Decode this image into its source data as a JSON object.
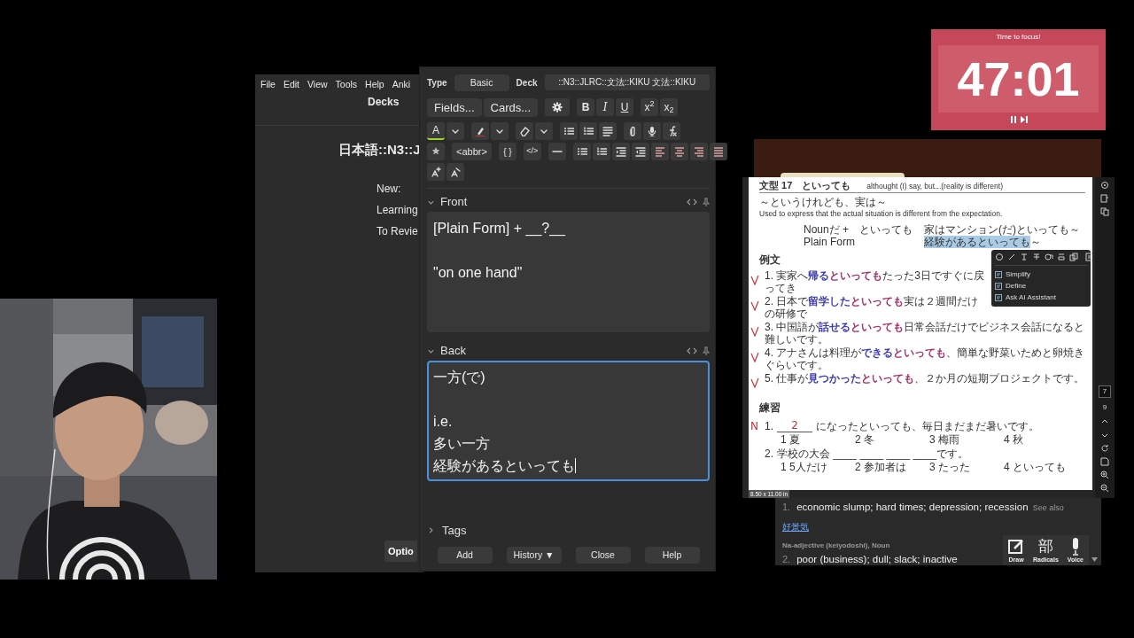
{
  "anki_main": {
    "menu": [
      "File",
      "Edit",
      "View",
      "Tools",
      "Help",
      "Anki"
    ],
    "heading": "Decks",
    "deck_name": "日本語::N3::J",
    "stats": [
      "New:",
      "Learning",
      "To Revie"
    ],
    "options_button": "Optio"
  },
  "editor": {
    "type_label": "Type",
    "note_type": "Basic",
    "deck_label": "Deck",
    "deck": "::N3::JLRC::文法::KIKU 文法::KIKU",
    "toolbar": {
      "fields": "Fields...",
      "cards": "Cards...",
      "bold": "B",
      "italic": "I",
      "underline": "U",
      "superscript": "x$^{2}$",
      "subscript": "x$_{2}$",
      "text_color": "A",
      "abbr": "<abbr>",
      "braces": "{ }",
      "code": "</>"
    },
    "fields": [
      {
        "name": "Front",
        "expanded": true,
        "focused": false,
        "caret": false,
        "lines": [
          {
            "text": "[Plain Form] + __?__"
          },
          {
            "text": "\"on one hand\"",
            "space_before": true
          }
        ]
      },
      {
        "name": "Back",
        "expanded": true,
        "focused": true,
        "caret": true,
        "lines": [
          {
            "text": "一方(で)"
          },
          {
            "text": "i.e.",
            "space_before": true
          },
          {
            "text": "多い一方"
          },
          {
            "text": "経験があるといっても"
          }
        ]
      }
    ],
    "tags": {
      "label": "Tags",
      "expanded": false
    },
    "buttons": [
      "Add",
      "History ▼",
      "Close",
      "Help"
    ]
  },
  "timer": {
    "label": "Time to focus!",
    "time": "47:01"
  },
  "pdf": {
    "title": "文型 17　といっても",
    "title_gloss": "althought (I) say, but...(reality is different)",
    "pattern": "～というけれども、実は～",
    "explanation": "Used to express that the actual situation is different from the expectation.",
    "forms": [
      {
        "form": "Nounだ +　といっても",
        "example": [
          {
            "text": "家はマンション(だ)といっても～",
            "selected": false
          }
        ]
      },
      {
        "form": "Plain Form",
        "example": [
          {
            "text": "経験があるといっても",
            "selected": true
          },
          {
            "text": "～",
            "selected": false
          }
        ]
      }
    ],
    "examples_heading": "例文",
    "examples": [
      {
        "checked": true,
        "segments": [
          {
            "text": "1. 実家へ"
          },
          {
            "text": "帰る",
            "color": "#3c3cb0"
          },
          {
            "text": "といっても",
            "color": "#a8306c"
          },
          {
            "text": "たった3日ですぐに戻ってき"
          }
        ]
      },
      {
        "checked": true,
        "segments": [
          {
            "text": "2. 日本で"
          },
          {
            "text": "留学した",
            "color": "#3c3cb0"
          },
          {
            "text": "といっても",
            "color": "#a8306c"
          },
          {
            "text": "実は２週間だけの研修で"
          }
        ]
      },
      {
        "checked": true,
        "segments": [
          {
            "text": "3. 中国語が"
          },
          {
            "text": "話せる",
            "color": "#3c3cb0"
          },
          {
            "text": "といっても",
            "color": "#a8306c"
          },
          {
            "text": "日常会話だけでビジネス会話になると難しいです。"
          }
        ]
      },
      {
        "checked": true,
        "segments": [
          {
            "text": "4. アナさんは料理が"
          },
          {
            "text": "できる",
            "color": "#3c3cb0"
          },
          {
            "text": "といっても",
            "color": "#a8306c"
          },
          {
            "text": "、簡単な野菜いためと卵焼きぐらいです。"
          }
        ]
      },
      {
        "checked": true,
        "segments": [
          {
            "text": "5. 仕事が"
          },
          {
            "text": "見つかった",
            "color": "#3c3cb0"
          },
          {
            "text": "といっても",
            "color": "#a8306c"
          },
          {
            "text": "、２か月の短期プロジェクトです。"
          }
        ]
      }
    ],
    "practice_heading": "練習",
    "exercises": [
      {
        "grade": "N",
        "number": "1.",
        "answer": "2",
        "text": "になったといっても、毎日まだまだ暑いです。",
        "choices": [
          "1 夏",
          "2 冬",
          "3 梅雨",
          "4 秋"
        ]
      },
      {
        "number": "2.",
        "text": "学校の大会 ____ ____ ____ ____です。",
        "choices": [
          "1 5人だけ",
          "2 参加者は",
          "3 たった",
          "4 といっても"
        ]
      }
    ],
    "popup": {
      "items": [
        "Simplify",
        "Define",
        "Ask AI Assistant"
      ]
    },
    "page_numbers": [
      "7",
      "9"
    ],
    "page_size": "8.50 x 11.00 in"
  },
  "dictionary": {
    "senses": [
      {
        "number": "1.",
        "gloss": "economic slump; hard times; depression; recession",
        "see_also_label": "See also",
        "see_also_link": "好景気"
      },
      {
        "pos": "Na-adjective (keiyodoshi), Noun",
        "number": "2.",
        "gloss": "poor (business); dull; slack; inactive"
      }
    ],
    "tools": [
      {
        "kind": "draw",
        "label": "Draw"
      },
      {
        "kind": "radicals",
        "glyph": "部",
        "label": "Radicals"
      },
      {
        "kind": "voice",
        "label": "Voice"
      }
    ]
  }
}
